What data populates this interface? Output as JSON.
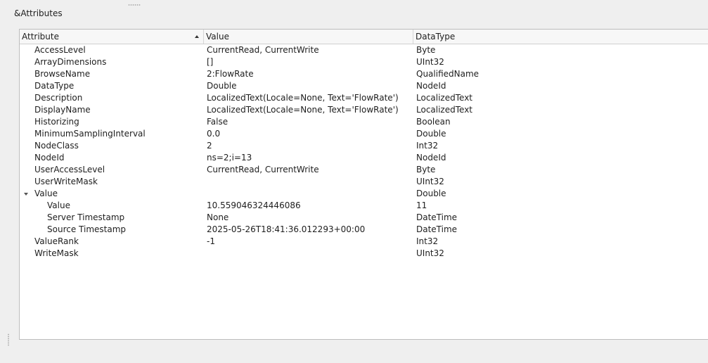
{
  "group": {
    "title": "&Attributes"
  },
  "columns": {
    "attribute": "Attribute",
    "value": "Value",
    "datatype": "DataType"
  },
  "rows": [
    {
      "attribute": "AccessLevel",
      "value": "CurrentRead, CurrentWrite",
      "datatype": "Byte"
    },
    {
      "attribute": "ArrayDimensions",
      "value": "[]",
      "datatype": "UInt32"
    },
    {
      "attribute": "BrowseName",
      "value": "2:FlowRate",
      "datatype": "QualifiedName"
    },
    {
      "attribute": "DataType",
      "value": "Double",
      "datatype": "NodeId"
    },
    {
      "attribute": "Description",
      "value": "LocalizedText(Locale=None, Text='FlowRate')",
      "datatype": "LocalizedText"
    },
    {
      "attribute": "DisplayName",
      "value": "LocalizedText(Locale=None, Text='FlowRate')",
      "datatype": "LocalizedText"
    },
    {
      "attribute": "Historizing",
      "value": "False",
      "datatype": "Boolean"
    },
    {
      "attribute": "MinimumSamplingInterval",
      "value": "0.0",
      "datatype": "Double"
    },
    {
      "attribute": "NodeClass",
      "value": "2",
      "datatype": "Int32"
    },
    {
      "attribute": "NodeId",
      "value": "ns=2;i=13",
      "datatype": "NodeId"
    },
    {
      "attribute": "UserAccessLevel",
      "value": "CurrentRead, CurrentWrite",
      "datatype": "Byte"
    },
    {
      "attribute": "UserWriteMask",
      "value": "",
      "datatype": "UInt32"
    },
    {
      "attribute": "Value",
      "value": "",
      "datatype": "Double"
    },
    {
      "attribute": "Value",
      "value": "10.559046324446086",
      "datatype": "11"
    },
    {
      "attribute": "Server Timestamp",
      "value": "None",
      "datatype": "DateTime"
    },
    {
      "attribute": "Source Timestamp",
      "value": "2025-05-26T18:41:36.012293+00:00",
      "datatype": "DateTime"
    },
    {
      "attribute": "ValueRank",
      "value": "-1",
      "datatype": "Int32"
    },
    {
      "attribute": "WriteMask",
      "value": "",
      "datatype": "UInt32"
    }
  ]
}
